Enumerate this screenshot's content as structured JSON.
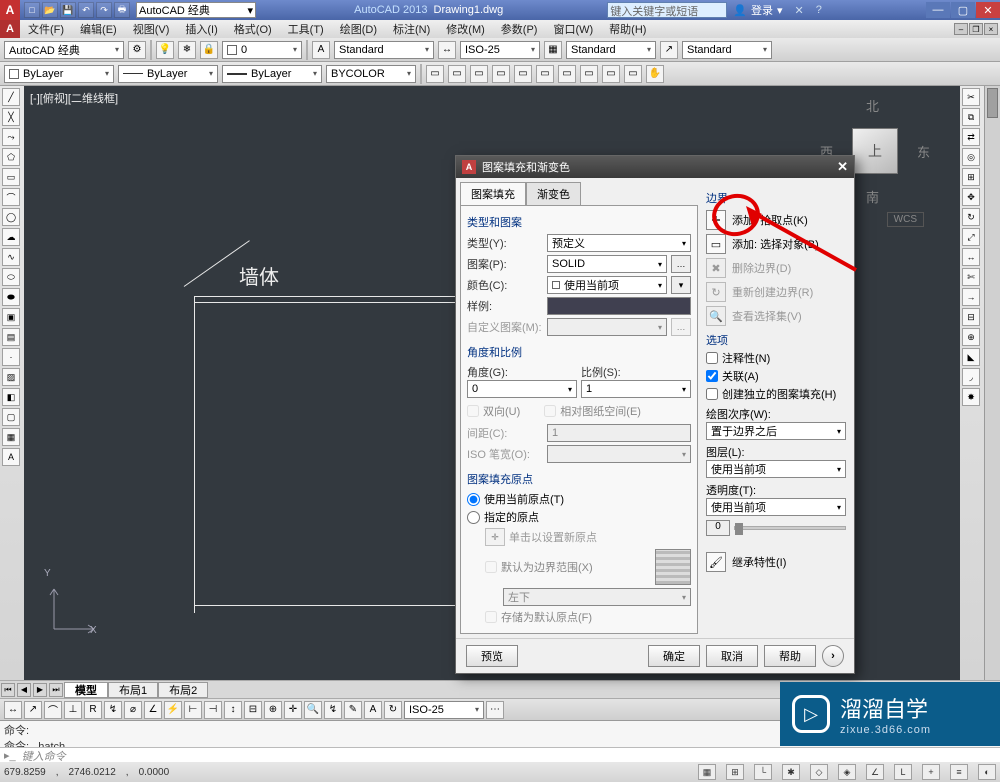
{
  "titlebar": {
    "workspace_combo": "AutoCAD 经典",
    "app_name": "AutoCAD 2013",
    "doc_name": "Drawing1.dwg",
    "search_placeholder": "键入关键字或短语",
    "login_label": "登录"
  },
  "menubar": {
    "items": [
      "文件(F)",
      "编辑(E)",
      "视图(V)",
      "插入(I)",
      "格式(O)",
      "工具(T)",
      "绘图(D)",
      "标注(N)",
      "修改(M)",
      "参数(P)",
      "窗口(W)",
      "帮助(H)"
    ]
  },
  "styles_row": {
    "workspace": "AutoCAD 经典",
    "layer_state": "0",
    "text_style": "Standard",
    "dim_style": "ISO-25",
    "table_style": "Standard",
    "ml_style": "Standard"
  },
  "layers_row": {
    "layer_filter": "ByLayer",
    "color": "ByLayer",
    "linetype": "ByLayer",
    "plotstyle": "BYCOLOR"
  },
  "canvas": {
    "view_label": "[-][俯视][二维线框]",
    "wall_label": "墙体",
    "cube_top": "上",
    "compass": {
      "n": "北",
      "s": "南",
      "e": "东",
      "w": "西"
    },
    "wcs": "WCS",
    "ucs_x": "X",
    "ucs_y": "Y"
  },
  "layout": {
    "tabs": [
      "模型",
      "布局1",
      "布局2"
    ]
  },
  "bottom_tb": {
    "dim_style": "ISO-25"
  },
  "cmd": {
    "line1": "命令:",
    "line2": "命令: _hatch",
    "prompt": "键入命令"
  },
  "status": {
    "coord_x": "679.8259",
    "coord_y": "2746.0212",
    "coord_z": "0.0000"
  },
  "dialog": {
    "title": "图案填充和渐变色",
    "tab_hatch": "图案填充",
    "tab_gradient": "渐变色",
    "type_pattern_group": "类型和图案",
    "type_label": "类型(Y):",
    "type_value": "预定义",
    "pattern_label": "图案(P):",
    "pattern_value": "SOLID",
    "color_label": "颜色(C):",
    "color_value": "使用当前项",
    "sample_label": "样例:",
    "custom_label": "自定义图案(M):",
    "angle_scale_group": "角度和比例",
    "angle_label": "角度(G):",
    "angle_value": "0",
    "scale_label": "比例(S):",
    "scale_value": "1",
    "double_label": "双向(U)",
    "paper_label": "相对图纸空间(E)",
    "spacing_label": "间距(C):",
    "spacing_value": "1",
    "iso_label": "ISO 笔宽(O):",
    "origin_group": "图案填充原点",
    "origin_use_current": "使用当前原点(T)",
    "origin_specified": "指定的原点",
    "origin_click": "单击以设置新原点",
    "origin_default_ext": "默认为边界范围(X)",
    "origin_pos": "左下",
    "origin_store": "存储为默认原点(F)",
    "boundaries_group": "边界",
    "add_pick": "添加: 拾取点(K)",
    "add_select": "添加: 选择对象(B)",
    "remove_boundary": "删除边界(D)",
    "recreate_boundary": "重新创建边界(R)",
    "view_selection": "查看选择集(V)",
    "options_group": "选项",
    "opt_annotative": "注释性(N)",
    "opt_associative": "关联(A)",
    "opt_separate": "创建独立的图案填充(H)",
    "draw_order_label": "绘图次序(W):",
    "draw_order_value": "置于边界之后",
    "layer_label": "图层(L):",
    "layer_value": "使用当前项",
    "transparency_label": "透明度(T):",
    "transparency_value": "使用当前项",
    "transparency_num": "0",
    "inherit": "继承特性(I)",
    "btn_preview": "预览",
    "btn_ok": "确定",
    "btn_cancel": "取消",
    "btn_help": "帮助"
  },
  "watermark": {
    "brand": "溜溜自学",
    "url": "zixue.3d66.com"
  }
}
